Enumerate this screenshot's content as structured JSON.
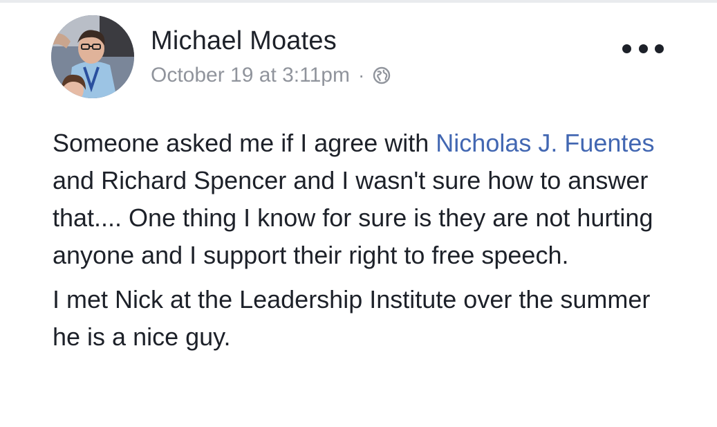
{
  "post": {
    "author": {
      "name": "Michael Moates",
      "avatar_icon": "profile-photo-icon"
    },
    "meta": {
      "timestamp": "October 19 at 3:11pm",
      "separator": "·",
      "audience_icon": "globe-icon"
    },
    "menu_icon": "more-options-icon",
    "body": {
      "paragraph1": {
        "text_before_mention": "Someone asked me if I agree with ",
        "mention": "Nicholas J. Fuentes",
        "text_after_mention": " and Richard Spencer and I wasn't sure how to answer that.... One thing I know for sure is they are not hurting anyone and I support their right to free speech."
      },
      "paragraph2": "I met Nick at the Leadership Institute over the summer he is a nice guy."
    }
  },
  "colors": {
    "text": "#1d2129",
    "meta_gray": "#90949c",
    "link_blue": "#4267b2"
  }
}
